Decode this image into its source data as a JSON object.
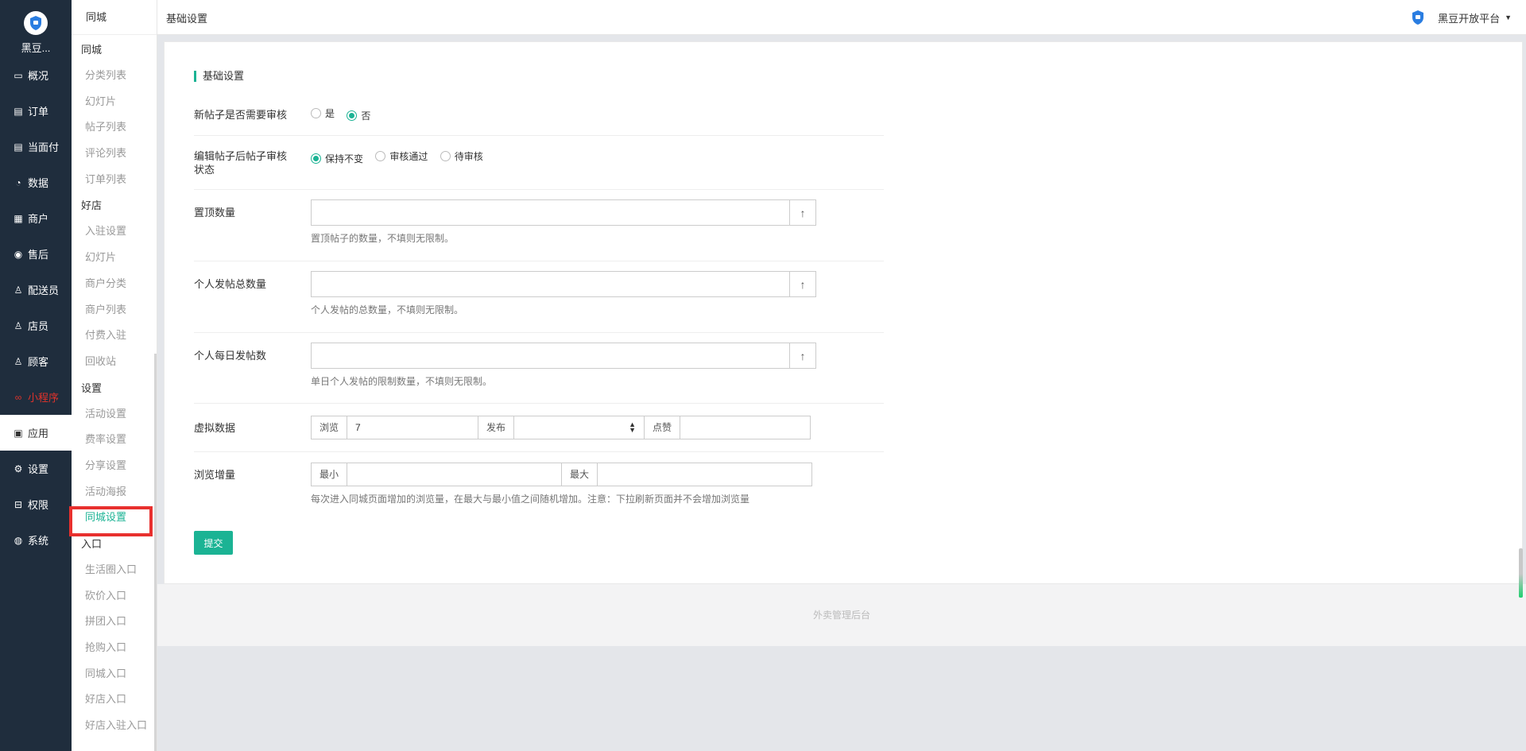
{
  "brand": {
    "name": "黑豆..."
  },
  "nav": [
    {
      "label": "概况",
      "icon": "overview-icon"
    },
    {
      "label": "订单",
      "icon": "order-icon"
    },
    {
      "label": "当面付",
      "icon": "pay-icon"
    },
    {
      "label": "数据",
      "icon": "data-icon"
    },
    {
      "label": "商户",
      "icon": "store-icon"
    },
    {
      "label": "售后",
      "icon": "aftersale-icon"
    },
    {
      "label": "配送员",
      "icon": "courier-icon"
    },
    {
      "label": "店员",
      "icon": "clerk-icon"
    },
    {
      "label": "顾客",
      "icon": "customer-icon"
    },
    {
      "label": "小程序",
      "icon": "miniapp-icon"
    },
    {
      "label": "应用",
      "icon": "apps-icon"
    },
    {
      "label": "设置",
      "icon": "gear-icon"
    },
    {
      "label": "权限",
      "icon": "lock-icon"
    },
    {
      "label": "系统",
      "icon": "system-icon"
    }
  ],
  "submenu": {
    "header": "同城",
    "groups": [
      {
        "title": "同城",
        "links": [
          "分类列表",
          "幻灯片",
          "帖子列表",
          "评论列表",
          "订单列表"
        ]
      },
      {
        "title": "好店",
        "links": [
          "入驻设置",
          "幻灯片",
          "商户分类",
          "商户列表",
          "付费入驻",
          "回收站"
        ]
      },
      {
        "title": "设置",
        "links": [
          "活动设置",
          "费率设置",
          "分享设置",
          "活动海报",
          "同城设置"
        ]
      },
      {
        "title": "入口",
        "links": [
          "生活圈入口",
          "砍价入口",
          "拼团入口",
          "抢购入口",
          "同城入口",
          "好店入口",
          "好店入驻入口"
        ]
      }
    ]
  },
  "topbar": {
    "breadcrumb": "基础设置",
    "user": "黑豆开放平台"
  },
  "form": {
    "section_title": "基础设置",
    "review": {
      "label": "新帖子是否需要审核",
      "options": [
        "是",
        "否"
      ],
      "selected": "否"
    },
    "edit_status": {
      "label": "编辑帖子后帖子审核状态",
      "options": [
        "保持不变",
        "审核通过",
        "待审核"
      ],
      "selected": "保持不变"
    },
    "top_count": {
      "label": "置顶数量",
      "value": "",
      "help": "置顶帖子的数量，不填则无限制。"
    },
    "total_posts": {
      "label": "个人发帖总数量",
      "value": "",
      "help": "个人发帖的总数量，不填则无限制。"
    },
    "daily_posts": {
      "label": "个人每日发帖数",
      "value": "",
      "help": "单日个人发帖的限制数量，不填则无限制。"
    },
    "virtual": {
      "label": "虚拟数据",
      "views_label": "浏览",
      "views_value": "7",
      "publish_label": "发布",
      "publish_value": "",
      "likes_label": "点赞",
      "likes_value": ""
    },
    "view_increment": {
      "label": "浏览增量",
      "min_label": "最小",
      "min_value": "",
      "max_label": "最大",
      "max_value": "",
      "help": "每次进入同城页面增加的浏览量，在最大与最小值之间随机增加。注意：下拉刷新页面并不会增加浏览量"
    },
    "submit_label": "提交"
  },
  "footer": "外卖管理后台"
}
